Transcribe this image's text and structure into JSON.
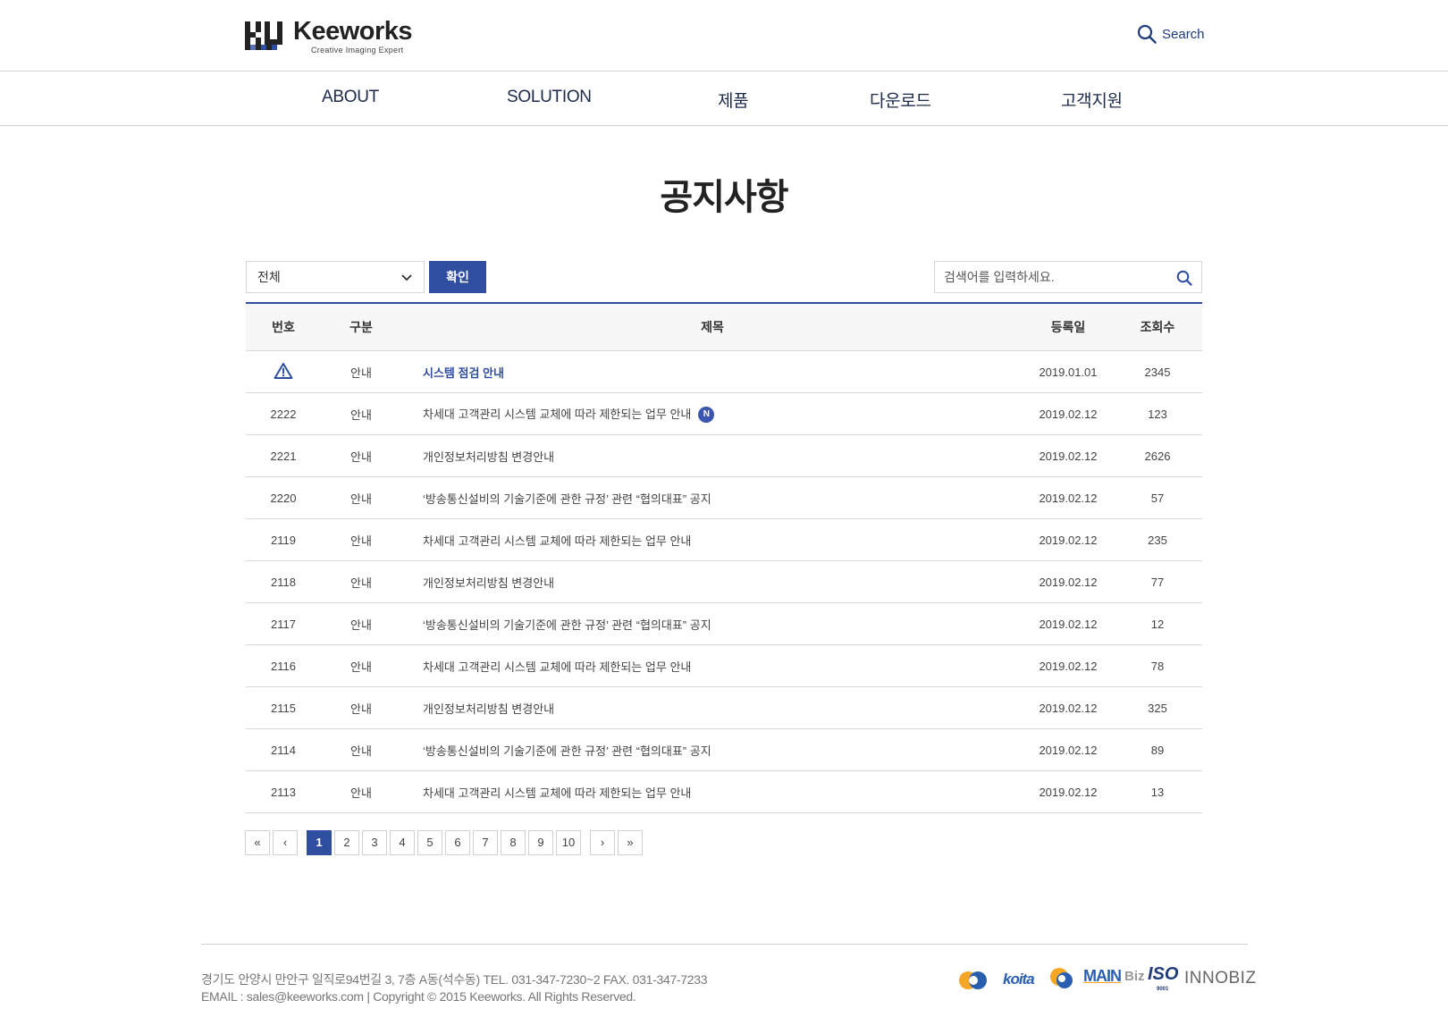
{
  "header": {
    "logo_name": "Keeworks",
    "logo_tagline": "Creative  Imaging  Expert",
    "search_label": "Search"
  },
  "nav": {
    "items": [
      {
        "label": "ABOUT"
      },
      {
        "label": "SOLUTION"
      },
      {
        "label": "제품"
      },
      {
        "label": "다운로드"
      },
      {
        "label": "고객지원"
      }
    ]
  },
  "page": {
    "title": "공지사항"
  },
  "filter": {
    "category_selected": "전체",
    "confirm_label": "확인",
    "search_placeholder": "검색어를 입력하세요."
  },
  "table": {
    "headers": {
      "no": "번호",
      "category": "구분",
      "title": "제목",
      "date": "등록일",
      "views": "조회수"
    },
    "rows": [
      {
        "no": "",
        "category": "안내",
        "title": "시스템 점검 안내",
        "date": "2019.01.01",
        "views": "2345",
        "notice": true,
        "new": false
      },
      {
        "no": "2222",
        "category": "안내",
        "title": "차세대 고객관리 시스템 교체에 따라 제한되는 업무 안내",
        "date": "2019.02.12",
        "views": "123",
        "notice": false,
        "new": true
      },
      {
        "no": "2221",
        "category": "안내",
        "title": "개인정보처리방침 변경안내",
        "date": "2019.02.12",
        "views": "2626",
        "notice": false,
        "new": false
      },
      {
        "no": "2220",
        "category": "안내",
        "title": "‘방송통신설비의 기술기준에 관한 규정’ 관련 “협의대표” 공지",
        "date": "2019.02.12",
        "views": "57",
        "notice": false,
        "new": false
      },
      {
        "no": "2119",
        "category": "안내",
        "title": "차세대 고객관리 시스템 교체에 따라 제한되는 업무 안내",
        "date": "2019.02.12",
        "views": "235",
        "notice": false,
        "new": false
      },
      {
        "no": "2118",
        "category": "안내",
        "title": "개인정보처리방침 변경안내",
        "date": "2019.02.12",
        "views": "77",
        "notice": false,
        "new": false
      },
      {
        "no": "2117",
        "category": "안내",
        "title": "‘방송통신설비의 기술기준에 관한 규정’ 관련 “협의대표” 공지",
        "date": "2019.02.12",
        "views": "12",
        "notice": false,
        "new": false
      },
      {
        "no": "2116",
        "category": "안내",
        "title": "차세대 고객관리 시스템 교체에 따라 제한되는 업무 안내",
        "date": "2019.02.12",
        "views": "78",
        "notice": false,
        "new": false
      },
      {
        "no": "2115",
        "category": "안내",
        "title": "개인정보처리방침 변경안내",
        "date": "2019.02.12",
        "views": "325",
        "notice": false,
        "new": false
      },
      {
        "no": "2114",
        "category": "안내",
        "title": "‘방송통신설비의 기술기준에 관한 규정’ 관련 “협의대표” 공지",
        "date": "2019.02.12",
        "views": "89",
        "notice": false,
        "new": false
      },
      {
        "no": "2113",
        "category": "안내",
        "title": "차세대 고객관리 시스템 교체에 따라 제한되는 업무 안내",
        "date": "2019.02.12",
        "views": "13",
        "notice": false,
        "new": false
      }
    ],
    "new_badge": "N"
  },
  "pagination": {
    "first": "«",
    "prev": "‹",
    "pages": [
      "1",
      "2",
      "3",
      "4",
      "5",
      "6",
      "7",
      "8",
      "9",
      "10"
    ],
    "current": "1",
    "next": "›",
    "last": "»"
  },
  "footer": {
    "address": "경기도 안양시 만안구 일직로94번길 3, 7층 A동(석수동)    TEL. 031-347-7230~2  FAX. 031-347-7233",
    "copyright": "EMAIL : sales@keeworks.com | Copyright © 2015 Keeworks. All Rights Reserved.",
    "certifications": [
      "koita",
      "MAIN",
      "Biz",
      "ISO",
      "9001",
      "INNOBIZ"
    ]
  },
  "colors": {
    "accent": "#2f4ea0",
    "nav_text": "#1c2a4a",
    "border": "#d8d8d8"
  }
}
